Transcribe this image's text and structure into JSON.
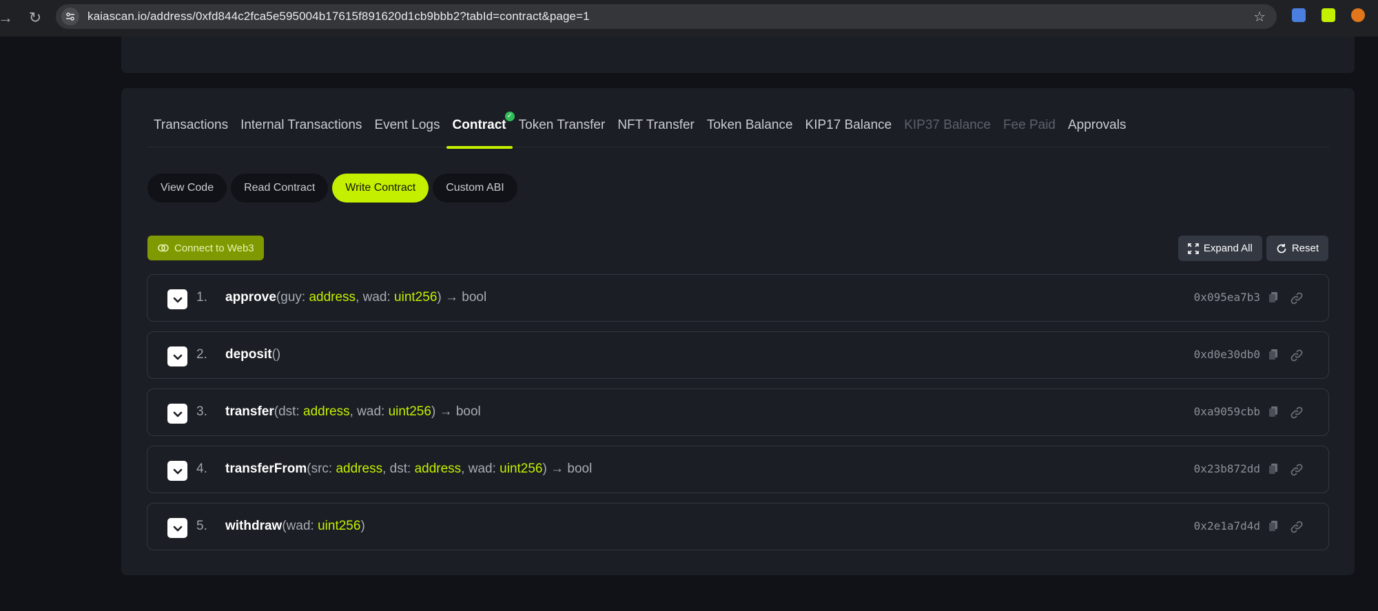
{
  "browser": {
    "url": "kaiascan.io/address/0xfd844c2fca5e595004b17615f891620d1cb9bbb2?tabId=contract&page=1"
  },
  "tabs": [
    {
      "label": "Transactions",
      "state": "normal"
    },
    {
      "label": "Internal Transactions",
      "state": "normal"
    },
    {
      "label": "Event Logs",
      "state": "normal"
    },
    {
      "label": "Contract",
      "state": "active"
    },
    {
      "label": "Token Transfer",
      "state": "normal"
    },
    {
      "label": "NFT Transfer",
      "state": "normal"
    },
    {
      "label": "Token Balance",
      "state": "normal"
    },
    {
      "label": "KIP17 Balance",
      "state": "normal"
    },
    {
      "label": "KIP37 Balance",
      "state": "disabled"
    },
    {
      "label": "Fee Paid",
      "state": "disabled"
    },
    {
      "label": "Approvals",
      "state": "normal"
    }
  ],
  "subtabs": [
    {
      "label": "View Code",
      "active": false
    },
    {
      "label": "Read Contract",
      "active": false
    },
    {
      "label": "Write Contract",
      "active": true
    },
    {
      "label": "Custom ABI",
      "active": false
    }
  ],
  "toolbar": {
    "connect_label": "Connect to Web3",
    "expand_label": "Expand All",
    "reset_label": "Reset"
  },
  "functions": [
    {
      "num": "1.",
      "name": "approve",
      "params": [
        {
          "name": "guy",
          "type": "address"
        },
        {
          "name": "wad",
          "type": "uint256"
        }
      ],
      "returns": "bool",
      "selector": "0x095ea7b3"
    },
    {
      "num": "2.",
      "name": "deposit",
      "params": [],
      "returns": "",
      "selector": "0xd0e30db0"
    },
    {
      "num": "3.",
      "name": "transfer",
      "params": [
        {
          "name": "dst",
          "type": "address"
        },
        {
          "name": "wad",
          "type": "uint256"
        }
      ],
      "returns": "bool",
      "selector": "0xa9059cbb"
    },
    {
      "num": "4.",
      "name": "transferFrom",
      "params": [
        {
          "name": "src",
          "type": "address"
        },
        {
          "name": "dst",
          "type": "address"
        },
        {
          "name": "wad",
          "type": "uint256"
        }
      ],
      "returns": "bool",
      "selector": "0x23b872dd"
    },
    {
      "num": "5.",
      "name": "withdraw",
      "params": [
        {
          "name": "wad",
          "type": "uint256"
        }
      ],
      "returns": "",
      "selector": "0x2e1a7d4d"
    }
  ],
  "colors": {
    "accent": "#c4f000",
    "page_bg": "#101217",
    "card_bg": "#1b1e24",
    "check_green": "#2ebd59"
  }
}
